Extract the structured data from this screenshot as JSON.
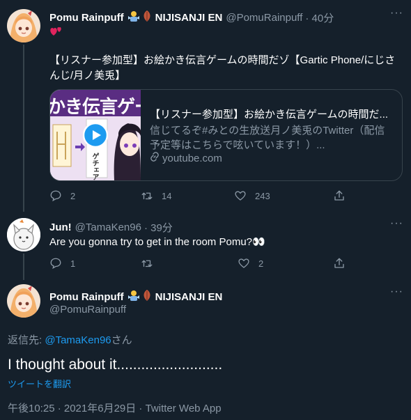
{
  "tweet1": {
    "display_name": "Pomu Rainpuff",
    "org": "NIJISANJI EN",
    "handle": "@PomuRainpuff",
    "time": "· 40分",
    "text": "【リスナー参加型】お絵かき伝言ゲームの時間だゾ【Gartic Phone/にじさんじ/月ノ美兎】",
    "text_line1": "【リスナー参加型】お絵かき伝言ゲームの時間だゾ【Gartic Phone/にじさ",
    "text_line2": "んじ/月ノ美兎】",
    "card": {
      "thumb_title": "かき伝言ゲーム",
      "thumb_label": "ゲチェア",
      "title": "【リスナー参加型】お絵かき伝言ゲームの時間だ...",
      "desc_line1": "信じてるぞ#みとの生放送月ノ美兎のTwitter（配信",
      "desc_line2": "予定等はこちらで呟いています！）...",
      "domain": "youtube.com"
    },
    "replies": "2",
    "retweets": "14",
    "likes": "243"
  },
  "tweet2": {
    "display_name": "Jun!",
    "handle": "@TamaKen96",
    "time": "· 39分",
    "text": "Are you gonna try to get in the room Pomu?👀",
    "replies": "1",
    "retweets": "",
    "likes": "2"
  },
  "main_tweet": {
    "display_name": "Pomu Rainpuff",
    "org": "NIJISANJI EN",
    "handle": "@PomuRainpuff",
    "reply_prefix": "返信先:",
    "reply_to": "@TamaKen96",
    "reply_suffix": "さん",
    "text": "I thought about it..........................",
    "translate": "ツイートを翻訳",
    "timestamp": "午後10:25 · 2021年6月29日 · Twitter Web App"
  },
  "icons": {
    "more": "more-dots-icon",
    "reply": "reply-icon",
    "retweet": "retweet-icon",
    "like": "heart-icon",
    "share": "share-icon",
    "play": "play-icon",
    "link": "link-icon"
  },
  "colors": {
    "background": "#15202b",
    "accent": "#1d9bf0",
    "muted": "#8b98a5",
    "border": "#38444d",
    "heart": "#e0245e"
  }
}
